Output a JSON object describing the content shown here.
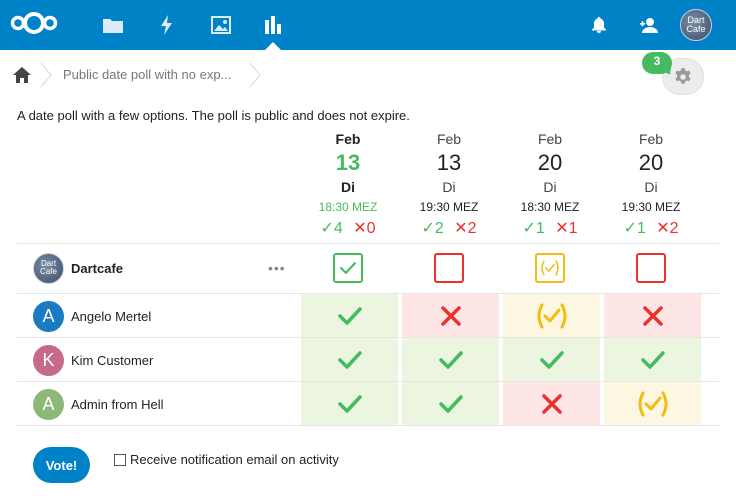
{
  "header": {
    "apps": [
      {
        "icon": "files-icon"
      },
      {
        "icon": "activity-icon"
      },
      {
        "icon": "gallery-icon"
      },
      {
        "icon": "polls-icon",
        "active": true
      }
    ],
    "right": [
      "notifications-icon",
      "contacts-icon"
    ],
    "avatar_text": "Dart Cafe"
  },
  "breadcrumb": {
    "title": "Public date poll with no exp..."
  },
  "comments_badge": "3",
  "description": "A date poll with a few options. The poll is public and does not expire.",
  "options": [
    {
      "month": "Feb",
      "day": "13",
      "weekday": "Di",
      "time": "18:30 MEZ",
      "yes": "4",
      "no": "0",
      "highlight": true
    },
    {
      "month": "Feb",
      "day": "13",
      "weekday": "Di",
      "time": "19:30 MEZ",
      "yes": "2",
      "no": "2"
    },
    {
      "month": "Feb",
      "day": "20",
      "weekday": "Di",
      "time": "18:30 MEZ",
      "yes": "1",
      "no": "1"
    },
    {
      "month": "Feb",
      "day": "20",
      "weekday": "Di",
      "time": "19:30 MEZ",
      "yes": "1",
      "no": "2"
    }
  ],
  "current_user": {
    "name": "Dartcafe",
    "avatar_text": "Dart Cafe",
    "votes": [
      "yes",
      "empty",
      "maybe",
      "empty"
    ]
  },
  "participants": [
    {
      "name": "Angelo Mertel",
      "initial": "A",
      "color": "#1a7bc2",
      "votes": [
        "yes",
        "no",
        "maybe",
        "no"
      ]
    },
    {
      "name": "Kim Customer",
      "initial": "K",
      "color": "#c7698a",
      "votes": [
        "yes",
        "yes",
        "yes",
        "yes"
      ]
    },
    {
      "name": "Admin from Hell",
      "initial": "A",
      "color": "#8db878",
      "votes": [
        "yes",
        "yes",
        "no",
        "maybe"
      ]
    }
  ],
  "vote_button": "Vote!",
  "notify_label": "Receive notification email on activity",
  "colors": {
    "brand": "#0082c9",
    "yes": "#46ba61",
    "no": "#e9322d",
    "maybe": "#f0bd13"
  }
}
